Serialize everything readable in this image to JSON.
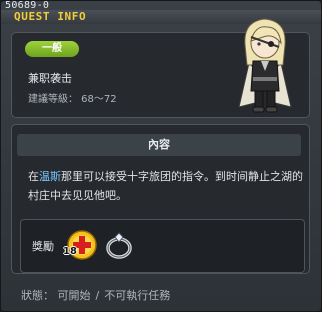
{
  "window": {
    "quest_id": "50689-0",
    "title": "QUEST INFO"
  },
  "quest": {
    "badge": "一般",
    "name": "兼职袭击",
    "recommended_level": "建議等級： 68～72"
  },
  "content": {
    "header": "內容",
    "desc_prefix": "在",
    "desc_highlight": "温斯",
    "desc_rest": "那里可以接受十字旅团的指令。到时间静止之湖的村庄中去见见他吧。"
  },
  "rewards": {
    "label": "獎勵",
    "items": [
      {
        "icon": "plus-potion-icon",
        "count": "18"
      },
      {
        "icon": "silver-ring-icon"
      }
    ]
  },
  "status": {
    "text": "狀態： 可開始",
    "separator": "/",
    "note": "不可執行任務"
  },
  "colors": {
    "title": "#f1ce3a",
    "badge": "#8cc430",
    "highlight": "#7cc6ff"
  }
}
